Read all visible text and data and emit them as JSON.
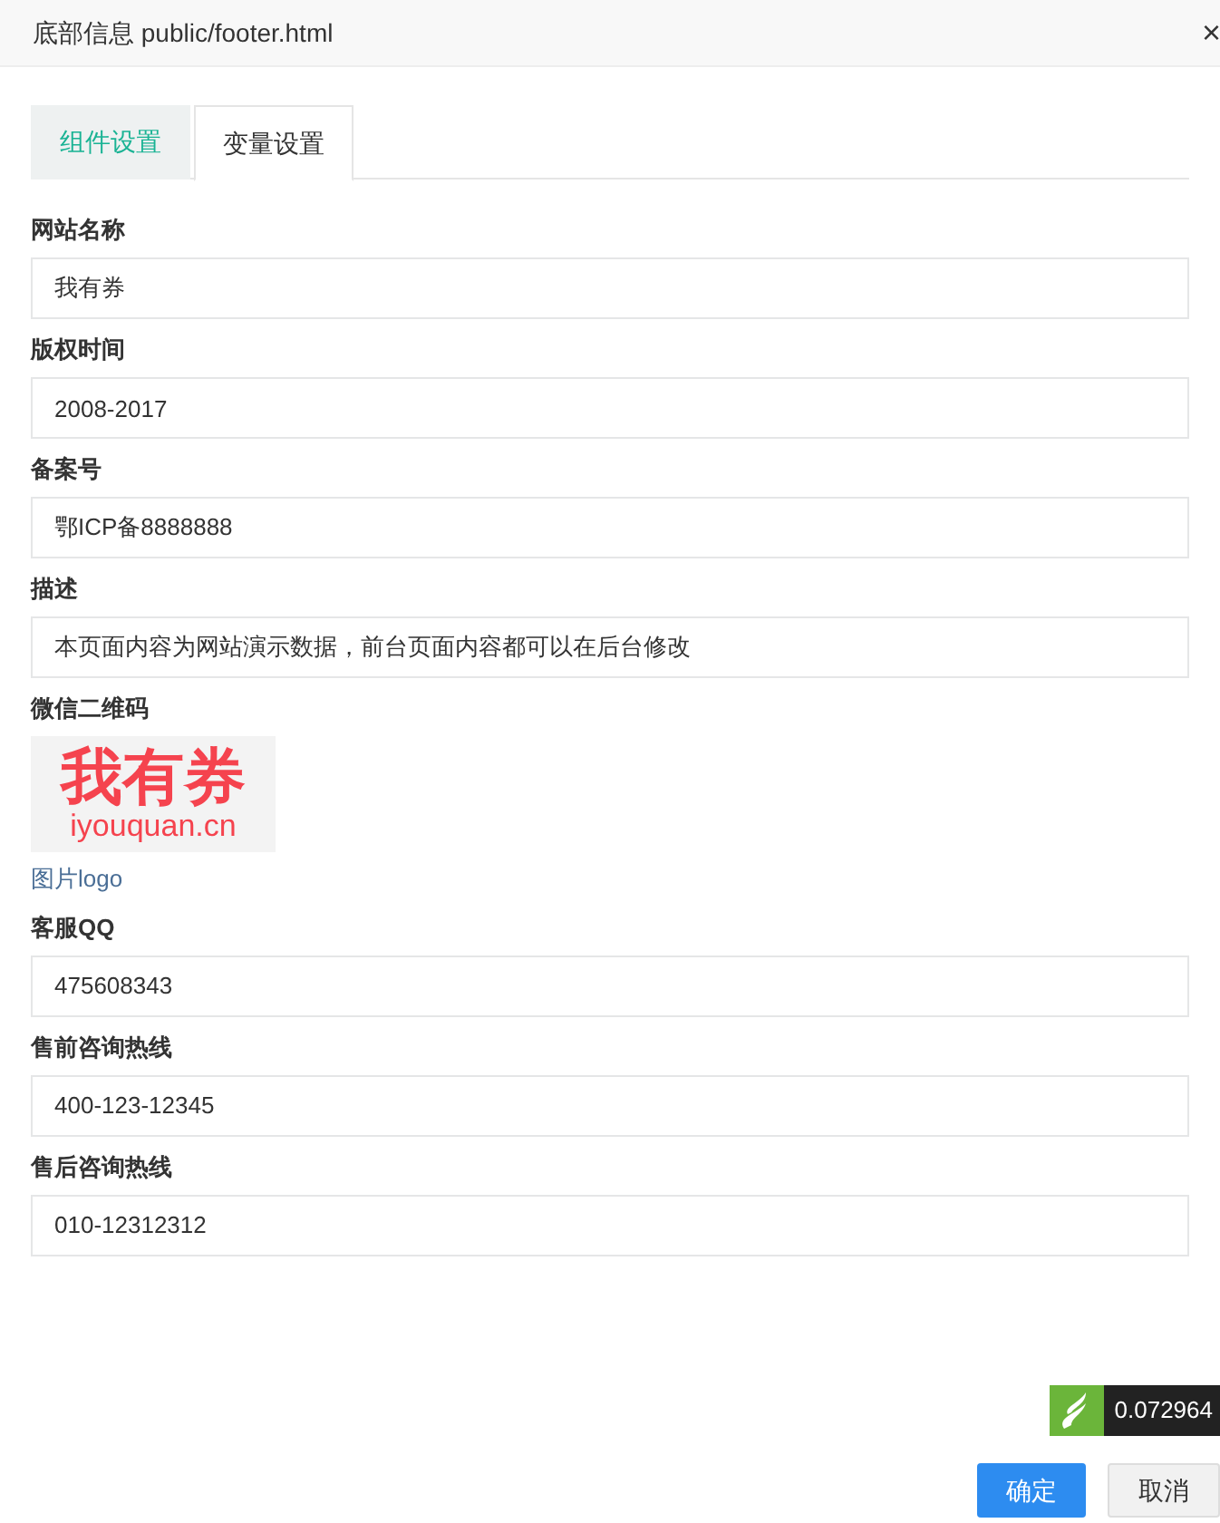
{
  "window": {
    "title": "底部信息 public/footer.html",
    "close": "×"
  },
  "tabs": [
    {
      "label": "组件设置",
      "selected": false
    },
    {
      "label": "变量设置",
      "selected": true
    }
  ],
  "fields": [
    {
      "kind": "text",
      "label": "网站名称",
      "value": "我有券"
    },
    {
      "kind": "text",
      "label": "版权时间",
      "value": "2008-2017"
    },
    {
      "kind": "text",
      "label": "备案号",
      "value": "鄂ICP备8888888"
    },
    {
      "kind": "text",
      "label": "描述",
      "value": "本页面内容为网站演示数据，前台页面内容都可以在后台修改"
    },
    {
      "kind": "image",
      "label": "微信二维码",
      "logo_text": "我有券",
      "logo_domain": "iyouquan.cn",
      "link": "图片logo"
    },
    {
      "kind": "text",
      "label": "客服QQ",
      "value": "475608343"
    },
    {
      "kind": "text",
      "label": "售前咨询热线",
      "value": "400-123-12345"
    },
    {
      "kind": "text",
      "label": "售后咨询热线",
      "value": "010-12312312"
    }
  ],
  "trace_badge": {
    "time": "0.072964"
  },
  "buttons": [
    {
      "label": "确定",
      "kind": "primary"
    },
    {
      "label": "取消",
      "kind": "default"
    }
  ]
}
